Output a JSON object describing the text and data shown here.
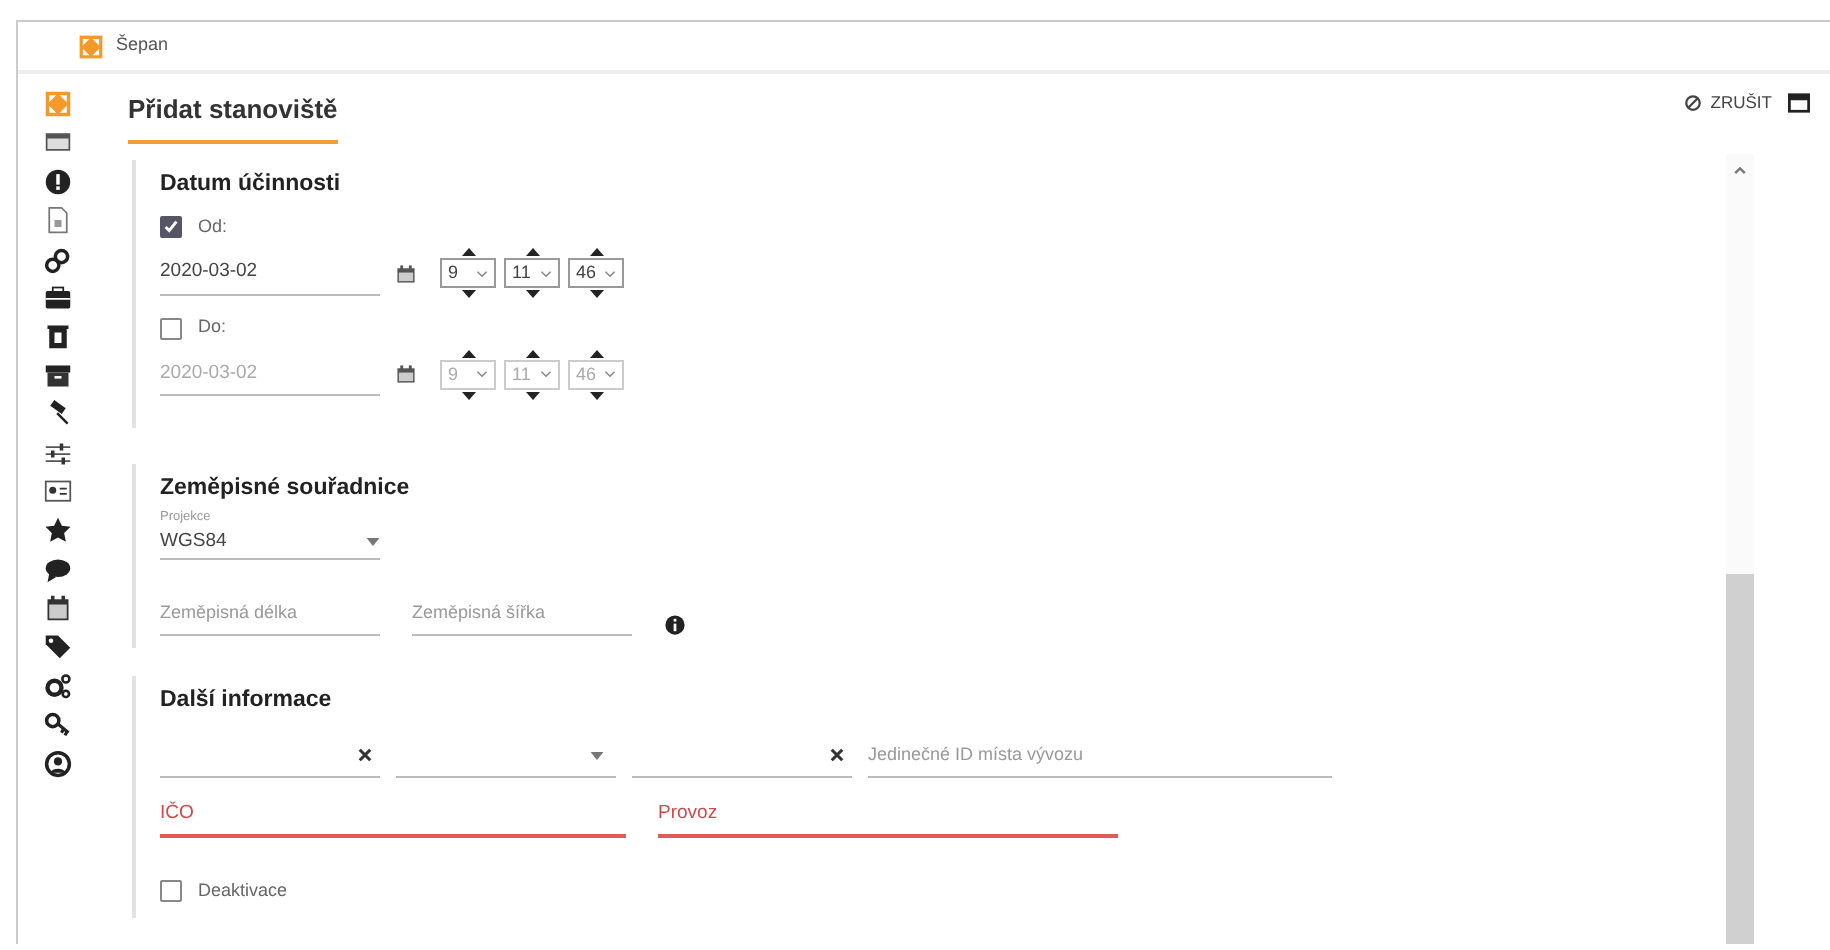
{
  "app": {
    "title": "Šepan"
  },
  "form": {
    "title": "Přidat stanoviště",
    "cancel_label": "ZRUŠIT",
    "validity": {
      "heading": "Datum účinnosti",
      "rows": [
        {
          "label": "Od:",
          "checked": true,
          "date": "2020-03-02",
          "hour": "9",
          "minute": "11",
          "second": "46"
        },
        {
          "label": "Do:",
          "checked": false,
          "date": "2020-03-02",
          "hour": "9",
          "minute": "11",
          "second": "46"
        }
      ]
    },
    "coordinates": {
      "heading": "Zeměpisné souřadnice",
      "projection": {
        "label": "Projekce",
        "value": "WGS84"
      },
      "longitude": {
        "placeholder": "Zeměpisná délka"
      },
      "latitude": {
        "placeholder": "Zeměpisná šířka"
      }
    },
    "more": {
      "heading": "Další informace",
      "fields": [
        {
          "kind": "clearable"
        },
        {
          "kind": "select"
        },
        {
          "kind": "clearable"
        },
        {
          "kind": "text",
          "placeholder": "Jedinečné ID místa vývozu"
        }
      ],
      "required": [
        {
          "placeholder": "IČO",
          "invalid": true
        },
        {
          "placeholder": "Provoz",
          "invalid": true
        }
      ],
      "deactivate": {
        "label": "Deaktivace",
        "checked": false
      }
    }
  }
}
